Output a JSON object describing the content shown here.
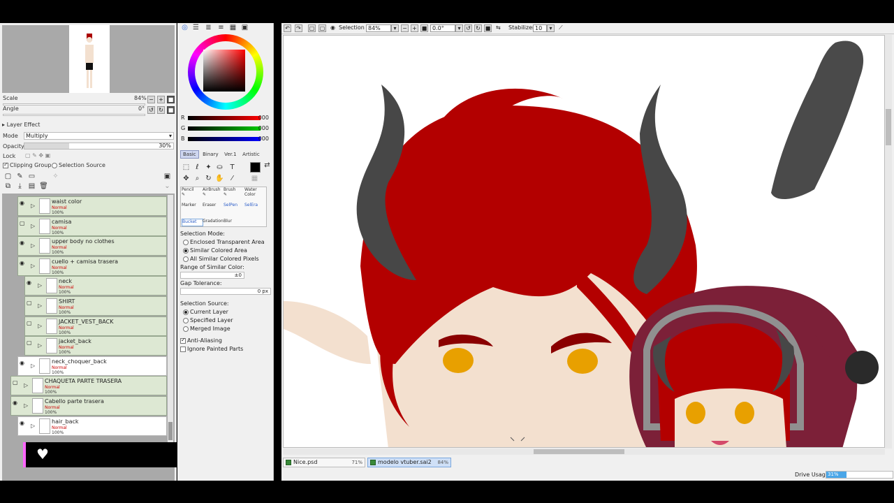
{
  "navigator": {
    "scale_label": "Scale",
    "scale_value": "84%",
    "angle_label": "Angle",
    "angle_value": "0°"
  },
  "layer_props": {
    "layer_effect": "Layer Effect",
    "mode_label": "Mode",
    "mode_value": "Multiply",
    "opacity_label": "Opacity",
    "opacity_value": "30%",
    "opacity_fraction": 0.3,
    "lock_label": "Lock",
    "clipping_group": "Clipping Group",
    "selection_source": "Selection Source"
  },
  "layers": [
    {
      "name": "waist color",
      "mode": "Normal",
      "opacity": "100%",
      "eye": true,
      "indent": 1,
      "white": false
    },
    {
      "name": "camisa",
      "mode": "Normal",
      "opacity": "100%",
      "eye": false,
      "indent": 1,
      "white": false
    },
    {
      "name": "upper body no clothes",
      "mode": "Normal",
      "opacity": "100%",
      "eye": true,
      "indent": 1,
      "white": false
    },
    {
      "name": "cuello + camisa trasera",
      "mode": "Normal",
      "opacity": "100%",
      "eye": true,
      "indent": 1,
      "white": false
    },
    {
      "name": "neck",
      "mode": "Normal",
      "opacity": "100%",
      "eye": true,
      "indent": 2,
      "white": false
    },
    {
      "name": "SHIRT",
      "mode": "Normal",
      "opacity": "100%",
      "eye": false,
      "indent": 2,
      "white": false
    },
    {
      "name": "JACKET_VEST_BACK",
      "mode": "Normal",
      "opacity": "100%",
      "eye": false,
      "indent": 2,
      "white": false
    },
    {
      "name": "jacket_back",
      "mode": "Normal",
      "opacity": "100%",
      "eye": false,
      "indent": 2,
      "white": false
    },
    {
      "name": "neck_choquer_back",
      "mode": "Normal",
      "opacity": "100%",
      "eye": true,
      "indent": 1,
      "white": true
    },
    {
      "name": "CHAQUETA PARTE TRASERA",
      "mode": "Normal",
      "opacity": "100%",
      "eye": false,
      "indent": 0,
      "white": false
    },
    {
      "name": "Cabello parte trasera",
      "mode": "Normal",
      "opacity": "100%",
      "eye": true,
      "indent": 0,
      "white": false
    },
    {
      "name": "hair_back",
      "mode": "Normal",
      "opacity": "100%",
      "eye": true,
      "indent": 1,
      "white": true
    }
  ],
  "color": {
    "r_label": "R",
    "r_value": "000",
    "g_label": "G",
    "g_value": "000",
    "b_label": "B",
    "b_value": "000",
    "tabs": [
      "Basic",
      "Binary",
      "Ver.1",
      "Artistic"
    ]
  },
  "brushes": {
    "row1": [
      "Pencil",
      "AirBrush",
      "Brush",
      "Water Color"
    ],
    "row2": [
      "Marker",
      "Eraser",
      "SelPen",
      "SelEra"
    ],
    "row3": [
      "Bucket",
      "Gradation",
      "Blur"
    ]
  },
  "bucket_options": {
    "selection_mode_label": "Selection Mode:",
    "mode_enclosed": "Enclosed Transparent Area",
    "mode_similar": "Similar Colored Area",
    "mode_all": "All Similar Colored Pixels",
    "range_label": "Range of Similar Color:",
    "range_value": "±0",
    "gap_label": "Gap Tolerance:",
    "gap_value": "0 px",
    "source_label": "Selection Source:",
    "source_current": "Current Layer",
    "source_specified": "Specified Layer",
    "source_merged": "Merged Image",
    "anti_aliasing": "Anti-Aliasing",
    "ignore_painted": "Ignore Painted Parts"
  },
  "canvas_toolbar": {
    "selection_label": "Selection",
    "zoom_value": "84%",
    "angle_value": "0.0°",
    "stabilizer_label": "Stabilizer",
    "stabilizer_value": "10"
  },
  "file_tabs": [
    {
      "name": "Nice.psd",
      "zoom": "71%",
      "active": false
    },
    {
      "name": "modelo vtuber.sai2",
      "zoom": "84%",
      "active": true
    }
  ],
  "status": {
    "drive_label": "Drive Usage",
    "drive_value": "31%",
    "drive_fraction": 0.31
  },
  "colors": {
    "hair": "#b30000",
    "horn": "#474747",
    "skin": "#f3e0cf",
    "eye": "#e8a000",
    "hood": "#7c2038"
  }
}
